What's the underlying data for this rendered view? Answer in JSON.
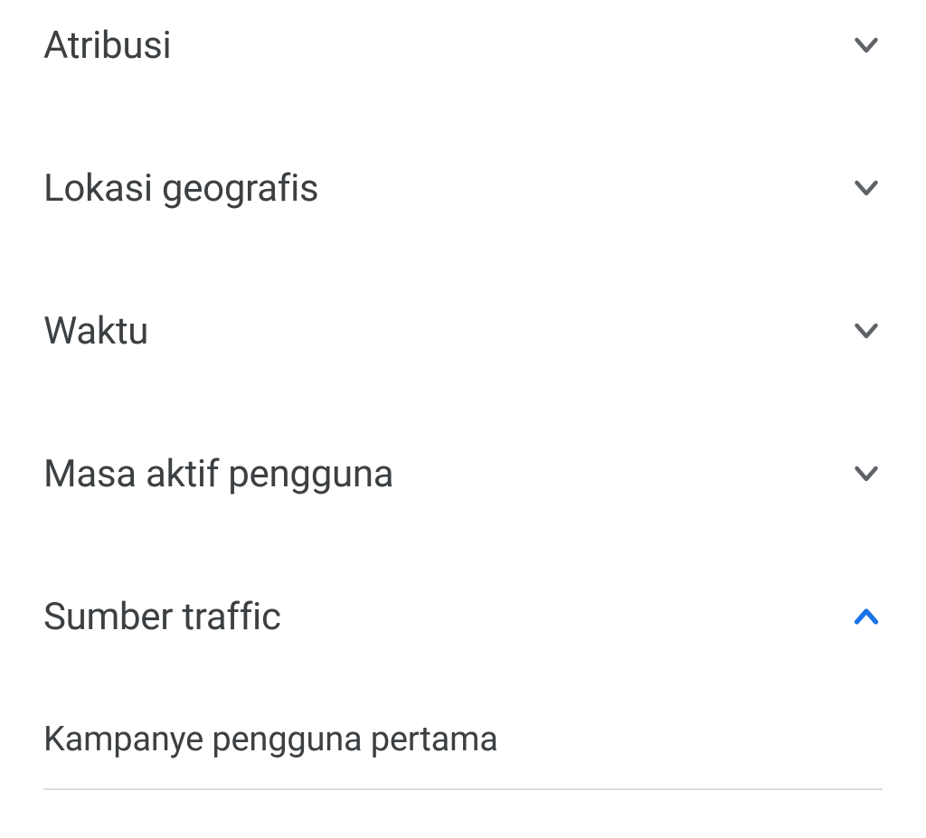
{
  "sections": [
    {
      "label": "Atribusi",
      "expanded": false
    },
    {
      "label": "Lokasi geografis",
      "expanded": false
    },
    {
      "label": "Waktu",
      "expanded": false
    },
    {
      "label": "Masa aktif pengguna",
      "expanded": false
    },
    {
      "label": "Sumber traffic",
      "expanded": true
    }
  ],
  "subItems": [
    {
      "label": "Kampanye pengguna pertama"
    }
  ]
}
